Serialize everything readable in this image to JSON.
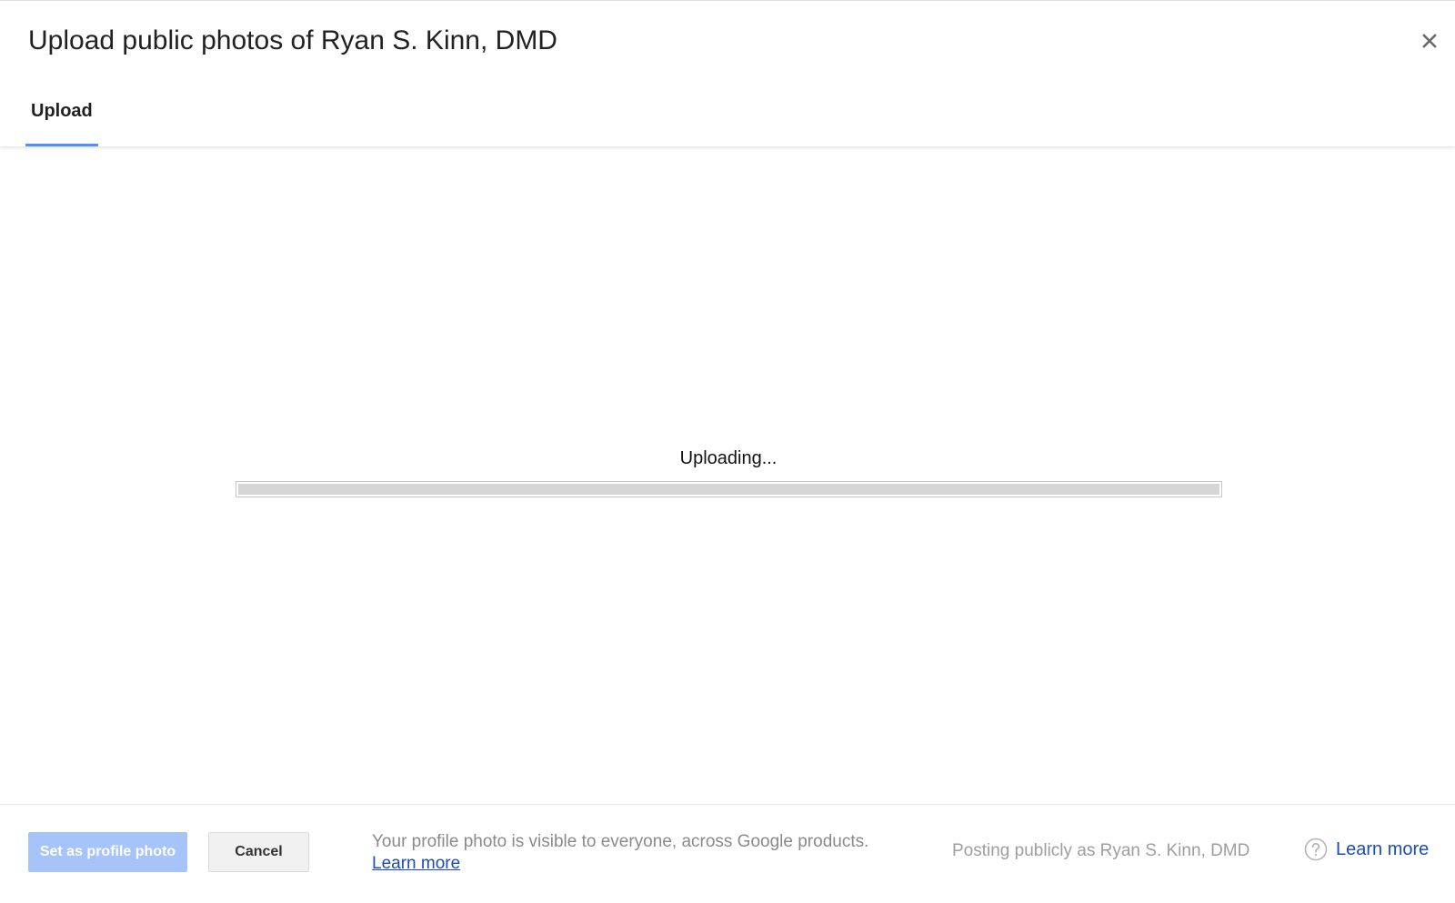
{
  "dialog": {
    "title": "Upload public photos of Ryan S. Kinn, DMD",
    "close_icon": "close-icon"
  },
  "tabs": [
    {
      "label": "Upload",
      "active": true
    }
  ],
  "upload": {
    "status": "Uploading...",
    "progress_fraction": 1.0
  },
  "footer": {
    "primary_button": "Set as profile photo",
    "cancel_button": "Cancel",
    "notice_text": "Your profile photo is visible to everyone, across Google products.",
    "notice_link": "Learn more",
    "posting_as": "Posting publicly as Ryan S. Kinn, DMD",
    "help_icon": "help-circle-icon",
    "help_link": "Learn more"
  },
  "colors": {
    "accent": "#4d90fe",
    "primary_button_disabled": "#a6c3fa",
    "link": "#1a4db5"
  }
}
